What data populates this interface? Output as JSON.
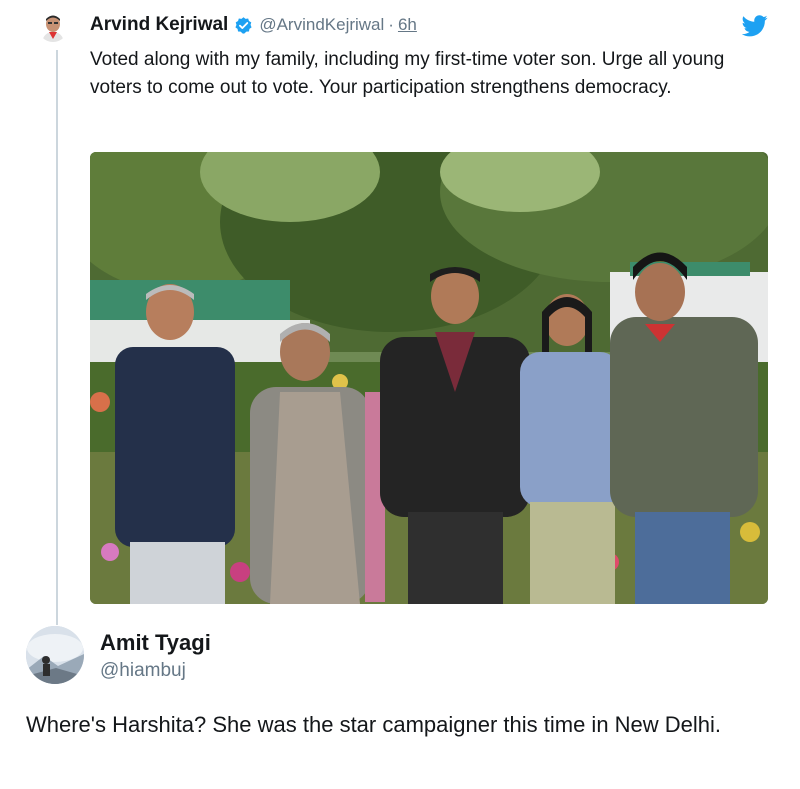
{
  "tweet": {
    "author_name": "Arvind Kejriwal",
    "author_handle": "@ArvindKejriwal",
    "separator": "·",
    "time": "6h",
    "text": "Voted along with my family, including my first-time voter son. Urge all young voters to come out to vote. Your participation strengthens democracy.",
    "verified_icon": "verified-badge-icon",
    "platform_icon": "twitter-bird-icon",
    "colors": {
      "accent": "#1da1f2",
      "muted": "#657786",
      "text": "#14171a",
      "thread_line": "#ccd6dd"
    }
  },
  "reply": {
    "author_name": "Amit Tyagi",
    "author_handle": "@hiambuj",
    "text": "Where's Harshita? She was the star campaigner this time in New Delhi."
  }
}
